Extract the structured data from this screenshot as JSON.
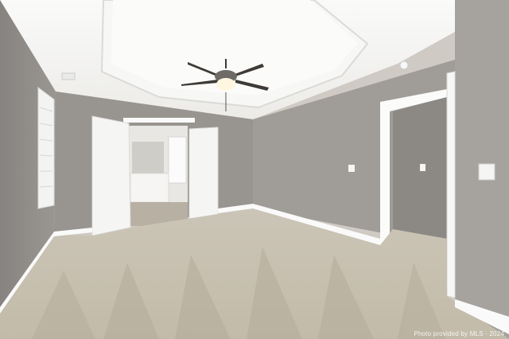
{
  "photo": {
    "subject": "empty-bedroom-interior",
    "palette": {
      "wall": "#8d8985",
      "wall_light": "#a29e99",
      "ceiling": "#f4f4f2",
      "carpet": "#c9c2b4",
      "trim": "#ffffff"
    }
  },
  "watermark": {
    "text": "Photo provided by MLS · 2024"
  }
}
